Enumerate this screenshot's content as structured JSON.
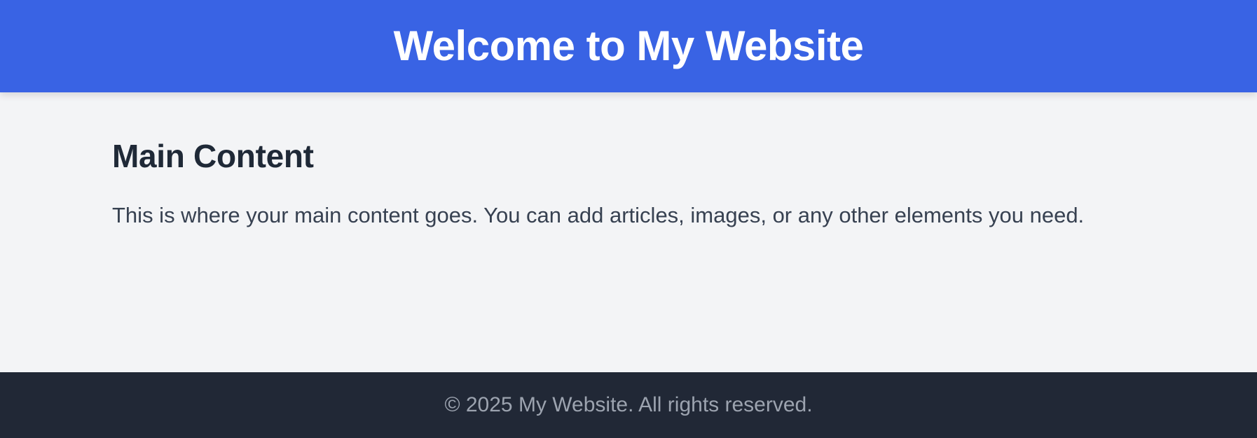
{
  "header": {
    "title": "Welcome to My Website"
  },
  "main": {
    "heading": "Main Content",
    "body": "This is where your main content goes. You can add articles, images, or any other elements you need."
  },
  "footer": {
    "copyright": "© 2025 My Website. All rights reserved."
  },
  "colors": {
    "header_bg": "#3963e4",
    "page_bg": "#f3f4f6",
    "footer_bg": "#212836",
    "footer_text": "#9ca3af",
    "heading_text": "#1f2937",
    "body_text": "#374151"
  }
}
